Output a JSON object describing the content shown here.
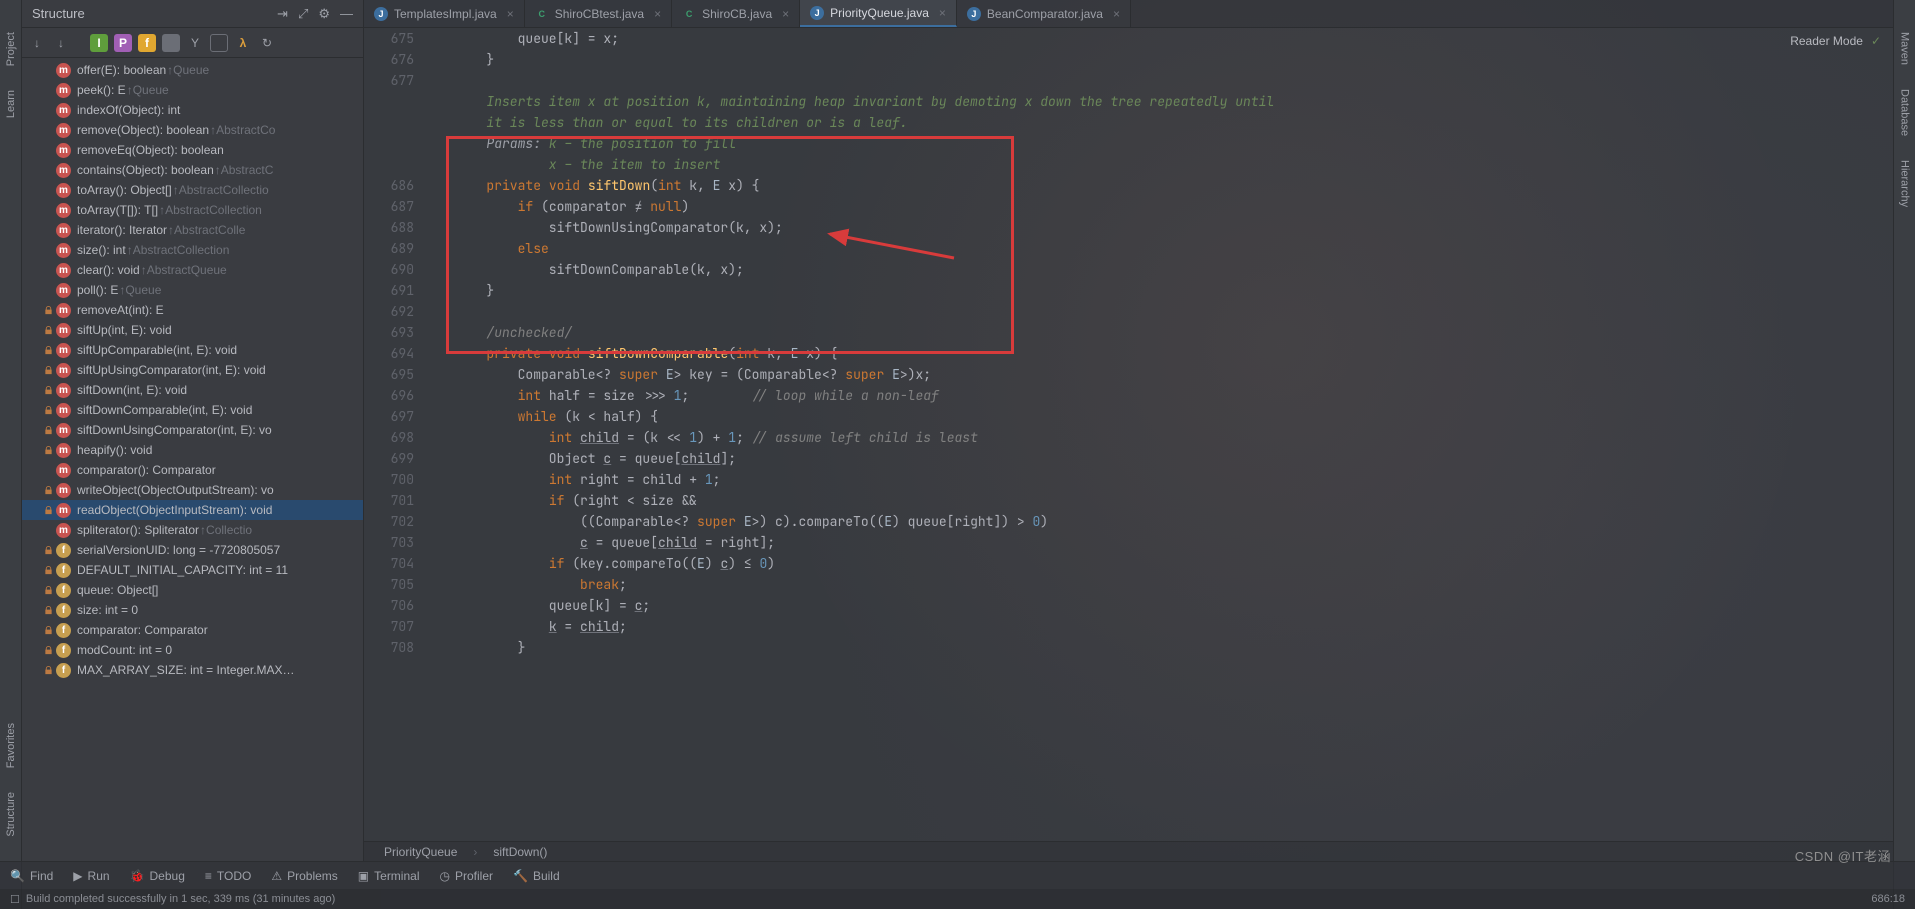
{
  "leftRail": [
    "Project",
    "Learn",
    "Favorites",
    "Structure"
  ],
  "rightRail": [
    "Maven",
    "Database",
    "Hierarchy"
  ],
  "structure": {
    "title": "Structure",
    "items": [
      {
        "badge": "m",
        "bm": true,
        "lock": false,
        "sig": "offer(E): boolean",
        "dim": " ↑Queue"
      },
      {
        "badge": "m",
        "bm": true,
        "lock": false,
        "sig": "peek(): E",
        "dim": " ↑Queue"
      },
      {
        "badge": "m",
        "bm": true,
        "lock": false,
        "sig": "indexOf(Object): int",
        "dim": ""
      },
      {
        "badge": "m",
        "bm": true,
        "lock": false,
        "sig": "remove(Object): boolean",
        "dim": " ↑AbstractCo"
      },
      {
        "badge": "m",
        "bm": true,
        "lock": false,
        "sig": "removeEq(Object): boolean",
        "dim": ""
      },
      {
        "badge": "m",
        "bm": true,
        "lock": false,
        "sig": "contains(Object): boolean",
        "dim": " ↑AbstractC"
      },
      {
        "badge": "m",
        "bm": true,
        "lock": false,
        "sig": "toArray(): Object[]",
        "dim": " ↑AbstractCollectio"
      },
      {
        "badge": "m",
        "bm": true,
        "lock": false,
        "sig": "toArray(T[]): T[]",
        "dim": " ↑AbstractCollection"
      },
      {
        "badge": "m",
        "bm": true,
        "lock": false,
        "sig": "iterator(): Iterator<E>",
        "dim": " ↑AbstractColle"
      },
      {
        "badge": "m",
        "bm": true,
        "lock": false,
        "sig": "size(): int",
        "dim": " ↑AbstractCollection"
      },
      {
        "badge": "m",
        "bm": true,
        "lock": false,
        "sig": "clear(): void",
        "dim": " ↑AbstractQueue"
      },
      {
        "badge": "m",
        "bm": true,
        "lock": false,
        "sig": "poll(): E",
        "dim": " ↑Queue"
      },
      {
        "badge": "m",
        "bm": true,
        "lock": true,
        "sig": "removeAt(int): E",
        "dim": ""
      },
      {
        "badge": "m",
        "bm": true,
        "lock": true,
        "sig": "siftUp(int, E): void",
        "dim": ""
      },
      {
        "badge": "m",
        "bm": true,
        "lock": true,
        "sig": "siftUpComparable(int, E): void",
        "dim": ""
      },
      {
        "badge": "m",
        "bm": true,
        "lock": true,
        "sig": "siftUpUsingComparator(int, E): void",
        "dim": ""
      },
      {
        "badge": "m",
        "bm": true,
        "lock": true,
        "sig": "siftDown(int, E): void",
        "dim": ""
      },
      {
        "badge": "m",
        "bm": true,
        "lock": true,
        "sig": "siftDownComparable(int, E): void",
        "dim": ""
      },
      {
        "badge": "m",
        "bm": true,
        "lock": true,
        "sig": "siftDownUsingComparator(int, E): vo",
        "dim": ""
      },
      {
        "badge": "m",
        "bm": true,
        "lock": true,
        "sig": "heapify(): void",
        "dim": ""
      },
      {
        "badge": "m",
        "bm": true,
        "lock": false,
        "sig": "comparator(): Comparator<? super E>",
        "dim": ""
      },
      {
        "badge": "m",
        "bm": true,
        "lock": true,
        "sig": "writeObject(ObjectOutputStream): vo",
        "dim": ""
      },
      {
        "badge": "m",
        "bm": true,
        "lock": true,
        "sig": "readObject(ObjectInputStream): void",
        "dim": "",
        "sel": true
      },
      {
        "badge": "m",
        "bm": true,
        "lock": false,
        "sig": "spliterator(): Spliterator<E>",
        "dim": " ↑Collectio"
      },
      {
        "badge": "f",
        "bm": false,
        "lock": true,
        "sig": "serialVersionUID: long = -7720805057",
        "dim": ""
      },
      {
        "badge": "f",
        "bm": false,
        "lock": true,
        "sig": "DEFAULT_INITIAL_CAPACITY: int = 11",
        "dim": ""
      },
      {
        "badge": "f",
        "bm": false,
        "lock": true,
        "sig": "queue: Object[]",
        "dim": ""
      },
      {
        "badge": "f",
        "bm": false,
        "lock": true,
        "sig": "size: int = 0",
        "dim": ""
      },
      {
        "badge": "f",
        "bm": false,
        "lock": true,
        "sig": "comparator: Comparator<? super E>",
        "dim": ""
      },
      {
        "badge": "f",
        "bm": false,
        "lock": true,
        "sig": "modCount: int = 0",
        "dim": ""
      },
      {
        "badge": "f",
        "bm": false,
        "lock": true,
        "sig": "MAX_ARRAY_SIZE: int = Integer.MAX…",
        "dim": ""
      }
    ]
  },
  "tabs": [
    {
      "icon": "j",
      "label": "TemplatesImpl.java",
      "close": true
    },
    {
      "icon": "c",
      "label": "ShiroCBtest.java",
      "close": true
    },
    {
      "icon": "c",
      "label": "ShiroCB.java",
      "close": true
    },
    {
      "icon": "j",
      "label": "PriorityQueue.java",
      "close": true,
      "active": true
    },
    {
      "icon": "j",
      "label": "BeanComparator.java",
      "close": true
    }
  ],
  "reader": {
    "label": "Reader Mode"
  },
  "gutterStart": 675,
  "breadcrumb": [
    "PriorityQueue",
    "siftDown()"
  ],
  "bottom": [
    {
      "icon": "search",
      "label": "Find"
    },
    {
      "icon": "play",
      "label": "Run"
    },
    {
      "icon": "bug",
      "label": "Debug"
    },
    {
      "icon": "check",
      "label": "TODO"
    },
    {
      "icon": "warn",
      "label": "Problems"
    },
    {
      "icon": "term",
      "label": "Terminal"
    },
    {
      "icon": "prof",
      "label": "Profiler"
    },
    {
      "icon": "hammer",
      "label": "Build"
    }
  ],
  "status": {
    "left": "Build completed successfully in 1 sec, 339 ms (31 minutes ago)",
    "pos": "686:18"
  },
  "watermark": "CSDN @IT老涵",
  "code": {
    "l675": "            queue[k] = x;",
    "l676": "        }",
    "l677": "",
    "doc1": "        Inserts item x at position k, maintaining heap invariant by demoting x down the tree repeatedly until",
    "doc2": "        it is less than or equal to its children or is a leaf.",
    "doc3": "        Params: k – the position to fill",
    "doc4": "                x – the item to insert",
    "l686": "        private void siftDown(int k, E x) {",
    "l687": "            if (comparator ≠ null)",
    "l688": "                siftDownUsingComparator(k, x);",
    "l689": "            else",
    "l690": "                siftDownComparable(k, x);",
    "l691": "        }",
    "l692": "",
    "l693": "        /unchecked/",
    "l694": "        private void siftDownComparable(int k, E x) {",
    "l695": "            Comparable<? super E> key = (Comparable<? super E>)x;",
    "l696": "            int half = size >>> 1;        // loop while a non-leaf",
    "l697": "            while (k < half) {",
    "l698": "                int child = (k << 1) + 1; // assume left child is least",
    "l699": "                Object c = queue[child];",
    "l700": "                int right = child + 1;",
    "l701": "                if (right < size &&",
    "l702": "                    ((Comparable<? super E>) c).compareTo((E) queue[right]) > 0)",
    "l703": "                    c = queue[child = right];",
    "l704": "                if (key.compareTo((E) c) ≤ 0)",
    "l705": "                    break;",
    "l706": "                queue[k] = c;",
    "l707": "                k = child;",
    "l708": "            }"
  }
}
